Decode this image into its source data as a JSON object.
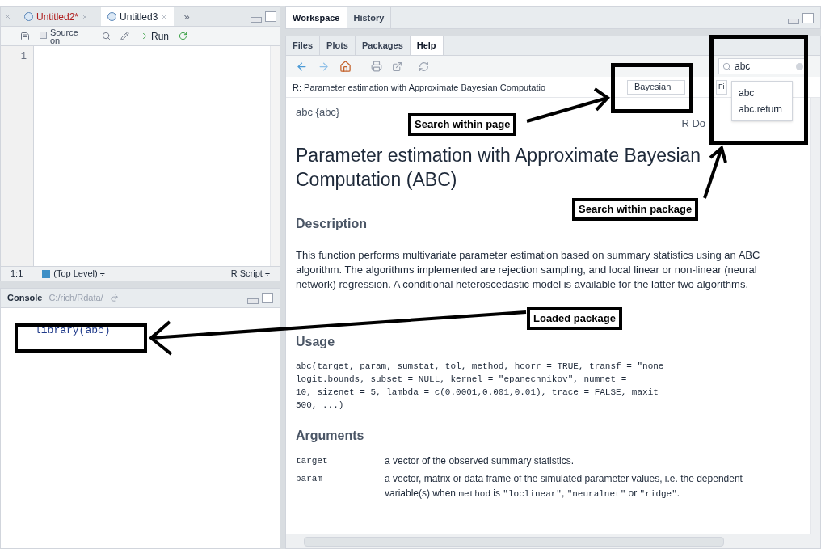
{
  "editor": {
    "tabs": [
      {
        "label": "Untitled2*",
        "selected": false,
        "modified": true
      },
      {
        "label": "Untitled3",
        "selected": true,
        "modified": false
      }
    ],
    "overflow": "»",
    "source_button": "Source on",
    "source_on_save": {
      "checked": false
    },
    "run_button": "Run",
    "line_numbers": [
      "1"
    ],
    "status": {
      "position": "1:1",
      "scope": "(Top Level) ÷",
      "file_type": "R Script ÷"
    }
  },
  "console": {
    "title": "Console",
    "path": "C:/rich/Rdata/",
    "lines": [
      "library(abc)"
    ]
  },
  "upper_right": {
    "tabs": [
      {
        "label": "Workspace",
        "selected": true
      },
      {
        "label": "History",
        "selected": false
      }
    ]
  },
  "help_pane": {
    "tabs": [
      {
        "label": "Files",
        "selected": false
      },
      {
        "label": "Plots",
        "selected": false
      },
      {
        "label": "Packages",
        "selected": false
      },
      {
        "label": "Help",
        "selected": true
      }
    ],
    "topic_title": "R: Parameter estimation with Approximate Bayesian Computatio",
    "find_field": {
      "value": "Bayesian"
    },
    "find_button": "Fi",
    "search_field": {
      "value": "abc"
    },
    "suggestions": [
      "abc",
      "abc.return"
    ],
    "doc_header_left": "abc {abc}",
    "doc_header_right": "R Do",
    "title": "Parameter estimation with Approximate Bayesian Computation (ABC)",
    "description_heading": "Description",
    "description": "This function performs multivariate parameter estimation based on summary statistics using an ABC algorithm. The algorithms implemented are rejection sampling, and local linear or non-linear (neural network) regression. A conditional heteroscedastic model is available for the latter two algorithms.",
    "usage_heading": "Usage",
    "usage_lines": [
      "abc(target, param, sumstat, tol, method, hcorr = TRUE, transf = \"none",
      "logit.bounds, subset = NULL, kernel = \"epanechnikov\", numnet =",
      "10, sizenet = 5, lambda = c(0.0001,0.001,0.01), trace = FALSE, maxit",
      "500, ...)"
    ],
    "arguments_heading": "Arguments",
    "arguments": [
      {
        "name": "target",
        "description": [
          {
            "text": "a vector of the observed summary statistics.",
            "code": false
          }
        ]
      },
      {
        "name": "param",
        "description": [
          {
            "text": "a vector, matrix or data frame of the simulated parameter values, i.e. the dependent variable(s) when ",
            "code": false
          },
          {
            "text": "method",
            "code": true
          },
          {
            "text": " is ",
            "code": false
          },
          {
            "text": "\"loclinear\"",
            "code": true
          },
          {
            "text": ", ",
            "code": false
          },
          {
            "text": "\"neuralnet\"",
            "code": true
          },
          {
            "text": " or ",
            "code": false
          },
          {
            "text": "\"ridge\"",
            "code": true
          },
          {
            "text": ".",
            "code": false
          }
        ]
      }
    ]
  },
  "annotations": [
    "Search within page",
    "Search within package",
    "Loaded package"
  ]
}
